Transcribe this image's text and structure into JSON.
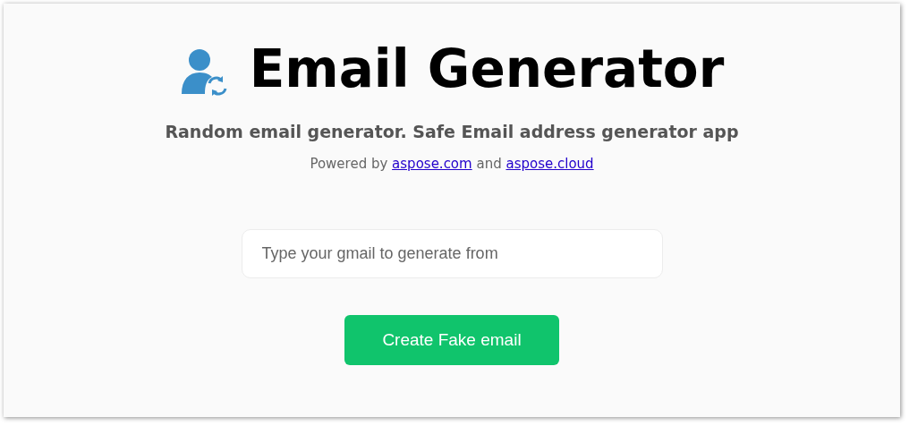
{
  "header": {
    "title": "Email Generator",
    "subtitle": "Random email generator. Safe Email address generator app"
  },
  "powered": {
    "prefix": "Powered by",
    "first_link": "aspose.com",
    "joiner": "and",
    "second_link": "aspose.cloud"
  },
  "email_field": {
    "placeholder": "Type your gmail to generate from"
  },
  "create_button": {
    "label": "Create Fake email"
  }
}
